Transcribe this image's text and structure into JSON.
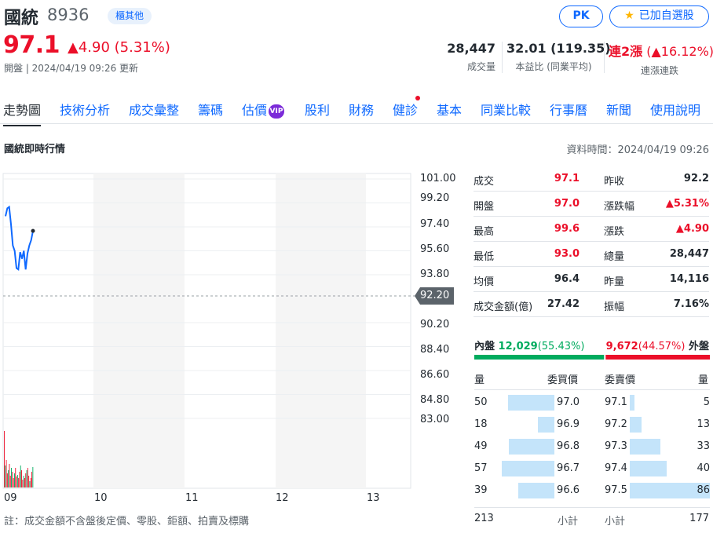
{
  "header": {
    "name": "國統",
    "code": "8936",
    "category": "櫃其他",
    "pk_label": "PK",
    "watchlist_label": "已加自選股",
    "price": "97.1",
    "change": "▲4.90 (5.31%)",
    "status": "開盤 | 2024/04/19 09:26 更新"
  },
  "stats": [
    {
      "value": "28,447",
      "label": "成交量"
    },
    {
      "value": "32.01 (119.35)",
      "label": "本益比 (同業平均)"
    },
    {
      "value_prefix": "連2漲",
      "value_suffix": " (▲16.12%)",
      "label": "連漲連跌"
    }
  ],
  "tabs": [
    "走勢圖",
    "技術分析",
    "成交彙整",
    "籌碼",
    "估價",
    "股利",
    "財務",
    "健診",
    "基本",
    "同業比較",
    "行事曆",
    "新聞",
    "使用說明"
  ],
  "vip_label": "VIP",
  "section": {
    "title": "國統即時行情",
    "time": "資料時間：2024/04/19 09:26"
  },
  "chart": {
    "y_labels": [
      "101.00",
      "99.20",
      "97.40",
      "95.60",
      "93.80",
      "92.20",
      "90.20",
      "88.40",
      "86.60",
      "84.80",
      "83.00"
    ],
    "ref_price": "92.20",
    "x_labels": [
      "09",
      "10",
      "11",
      "12",
      "13"
    ],
    "line_color": "#0f69ff",
    "footnote": "註：成交金額不含盤後定價、零股、鉅額、拍賣及標購"
  },
  "chart_data": {
    "type": "line",
    "x_labels": [
      "09",
      "10",
      "11",
      "12",
      "13"
    ],
    "ylim": [
      83.0,
      101.0
    ],
    "reference_line": 92.2,
    "series": [
      {
        "values": [
          98.2,
          98.8,
          98.9,
          97.6,
          96.0,
          95.6,
          94.3,
          94.2,
          95.5,
          95.0,
          95.6,
          94.2,
          95.4,
          96.0,
          96.4,
          97.1
        ]
      }
    ],
    "volume": {
      "values": [
        72,
        28,
        35,
        18,
        22,
        30,
        15,
        25,
        20,
        12,
        18,
        25,
        14,
        16,
        12,
        20,
        28,
        22,
        10,
        15,
        12,
        18,
        22,
        25,
        15,
        8,
        12,
        20,
        26
      ]
    }
  },
  "quote_table": [
    {
      "l1": "成交",
      "v1": "97.1",
      "c1": "red",
      "l2": "昨收",
      "v2": "92.2",
      "c2": "black"
    },
    {
      "l1": "開盤",
      "v1": "97.0",
      "c1": "red",
      "l2": "漲跌幅",
      "v2": "▲5.31%",
      "c2": "red"
    },
    {
      "l1": "最高",
      "v1": "99.6",
      "c1": "red",
      "l2": "漲跌",
      "v2": "▲4.90",
      "c2": "red"
    },
    {
      "l1": "最低",
      "v1": "93.0",
      "c1": "red",
      "l2": "總量",
      "v2": "28,447",
      "c2": "black"
    },
    {
      "l1": "均價",
      "v1": "96.4",
      "c1": "black",
      "l2": "昨量",
      "v2": "14,116",
      "c2": "black"
    },
    {
      "l1": "成交金額(億)",
      "v1": "27.42",
      "c1": "black",
      "l2": "振幅",
      "v2": "7.16%",
      "c2": "black"
    }
  ],
  "inner_outer": {
    "inner_prefix": "內盤",
    "inner_value": "12,029",
    "inner_pct": "(55.43%)",
    "outer_value": "9,672",
    "outer_pct": "(44.57%)",
    "outer_suffix": "外盤",
    "inner_ratio": 0.5543
  },
  "order_book": {
    "bid_headers": [
      "量",
      "委買價"
    ],
    "ask_headers": [
      "委賣價",
      "量"
    ],
    "bids": [
      {
        "qty": "50",
        "price": "97.0",
        "ratio": 0.58
      },
      {
        "qty": "18",
        "price": "96.9",
        "ratio": 0.21
      },
      {
        "qty": "49",
        "price": "96.8",
        "ratio": 0.57
      },
      {
        "qty": "57",
        "price": "96.7",
        "ratio": 0.66
      },
      {
        "qty": "39",
        "price": "96.6",
        "ratio": 0.45
      }
    ],
    "asks": [
      {
        "price": "97.1",
        "qty": "5",
        "ratio": 0.06
      },
      {
        "price": "97.2",
        "qty": "13",
        "ratio": 0.15
      },
      {
        "price": "97.3",
        "qty": "33",
        "ratio": 0.38
      },
      {
        "price": "97.4",
        "qty": "40",
        "ratio": 0.46
      },
      {
        "price": "97.5",
        "qty": "86",
        "ratio": 1.0
      }
    ],
    "bid_total": "213",
    "bid_total_label": "小計",
    "ask_total_label": "小計",
    "ask_total": "177"
  }
}
